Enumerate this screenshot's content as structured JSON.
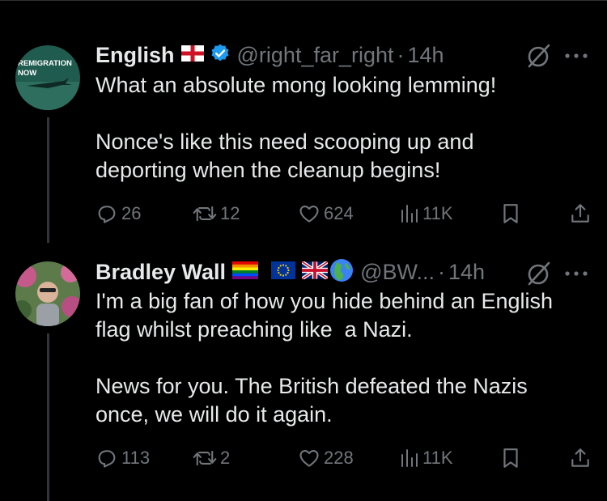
{
  "tweets": [
    {
      "avatar_text_line1": "REMIGRATION",
      "avatar_text_line2": "NOW",
      "name": "English",
      "handle": "@right_far_right",
      "separator": "·",
      "time": "14h",
      "text": "What an absolute mong looking lemming!\n\nNonce's like this need scooping up and\ndeporting when the cleanup begins!",
      "replies": "26",
      "reposts": "12",
      "likes": "624",
      "views": "11K"
    },
    {
      "name": "Bradley Wall",
      "handle": "@BW...",
      "separator": "·",
      "time": "14h",
      "text": "I'm a big fan of how you hide behind an English\nflag whilst preaching like  a Nazi.\n\nNews for you. The British defeated the Nazis\nonce, we will do it again.",
      "replies": "113",
      "reposts": "2",
      "likes": "228",
      "views": "11K"
    }
  ],
  "colors": {
    "background": "#000000",
    "text": "#e7e9ea",
    "secondary": "#71767b",
    "verified": "#1d9bf0",
    "divider": "#2f3336"
  },
  "icons": [
    "reply-icon",
    "repost-icon",
    "like-icon",
    "views-icon",
    "bookmark-icon",
    "share-icon",
    "grok-icon",
    "more-icon",
    "verified-icon"
  ]
}
